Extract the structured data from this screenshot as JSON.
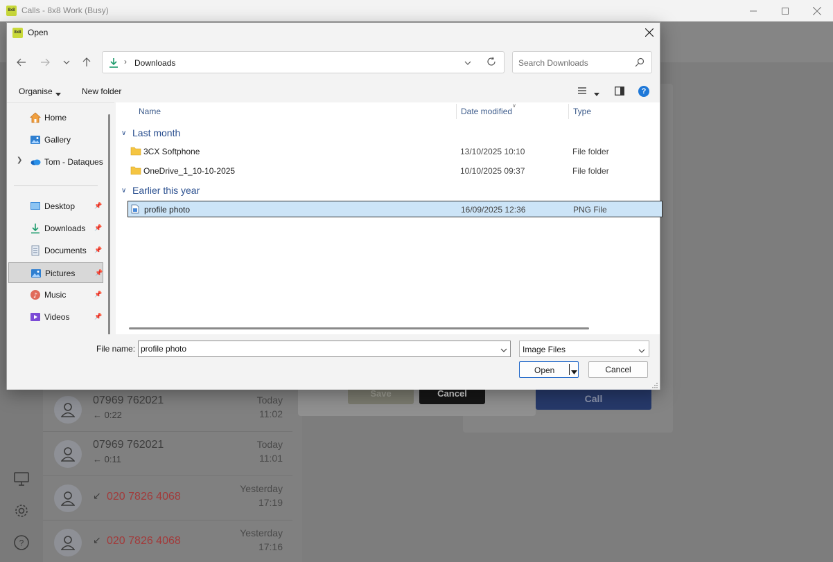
{
  "app": {
    "title": "Calls - 8x8 Work (Busy)",
    "logo_text": "8x8",
    "minimize_icon": "minimize-icon",
    "maximize_icon": "maximize-icon",
    "close_icon": "close-icon"
  },
  "background": {
    "calls": [
      {
        "number": "07969 762021",
        "duration": "← 0:22",
        "day": "Today",
        "time": "11:02",
        "missed": false
      },
      {
        "number": "07969 762021",
        "duration": "← 0:11",
        "day": "Today",
        "time": "11:01",
        "missed": false
      },
      {
        "number": "020 7826 4068",
        "duration": "",
        "day": "Yesterday",
        "time": "17:19",
        "missed": true
      },
      {
        "number": "020 7826 4068",
        "duration": "",
        "day": "Yesterday",
        "time": "17:16",
        "missed": true
      }
    ],
    "modal": {
      "save_label": "Save",
      "cancel_label": "Cancel"
    },
    "call_button_label": "Call"
  },
  "dialog": {
    "title": "Open",
    "logo_text": "8x8",
    "address": {
      "location": "Downloads"
    },
    "search": {
      "placeholder": "Search Downloads"
    },
    "toolbar": {
      "organise_label": "Organise",
      "new_folder_label": "New folder",
      "help_label": "?"
    },
    "nav": {
      "items": [
        {
          "label": "Home",
          "icon": "home-icon"
        },
        {
          "label": "Gallery",
          "icon": "gallery-icon"
        },
        {
          "label": "Tom - Dataques",
          "icon": "onedrive-icon"
        },
        {
          "label": "Desktop",
          "icon": "desktop-icon"
        },
        {
          "label": "Downloads",
          "icon": "downloads-icon"
        },
        {
          "label": "Documents",
          "icon": "documents-icon"
        },
        {
          "label": "Pictures",
          "icon": "pictures-icon"
        },
        {
          "label": "Music",
          "icon": "music-icon"
        },
        {
          "label": "Videos",
          "icon": "videos-icon"
        }
      ],
      "selected": "Pictures"
    },
    "columns": {
      "name": "Name",
      "date_modified": "Date modified",
      "type": "Type"
    },
    "groups": [
      {
        "title": "Last month",
        "files": [
          {
            "name": "3CX Softphone",
            "date": "13/10/2025 10:10",
            "type": "File folder",
            "icon": "folder-icon"
          },
          {
            "name": "OneDrive_1_10-10-2025",
            "date": "10/10/2025 09:37",
            "type": "File folder",
            "icon": "folder-icon"
          }
        ]
      },
      {
        "title": "Earlier this year",
        "files": [
          {
            "name": "profile photo",
            "date": "16/09/2025 12:36",
            "type": "PNG File",
            "icon": "png-file-icon"
          }
        ]
      }
    ],
    "footer": {
      "file_name_label": "File name:",
      "file_name_value": "profile photo",
      "file_type": "Image Files",
      "open_label": "Open",
      "cancel_label": "Cancel"
    }
  },
  "colors": {
    "accent": "#1e66c8",
    "selection": "#cce4f7",
    "group_header": "#2a4f8f",
    "missed_call": "#a23a3a",
    "brand": "#c9d93a"
  }
}
